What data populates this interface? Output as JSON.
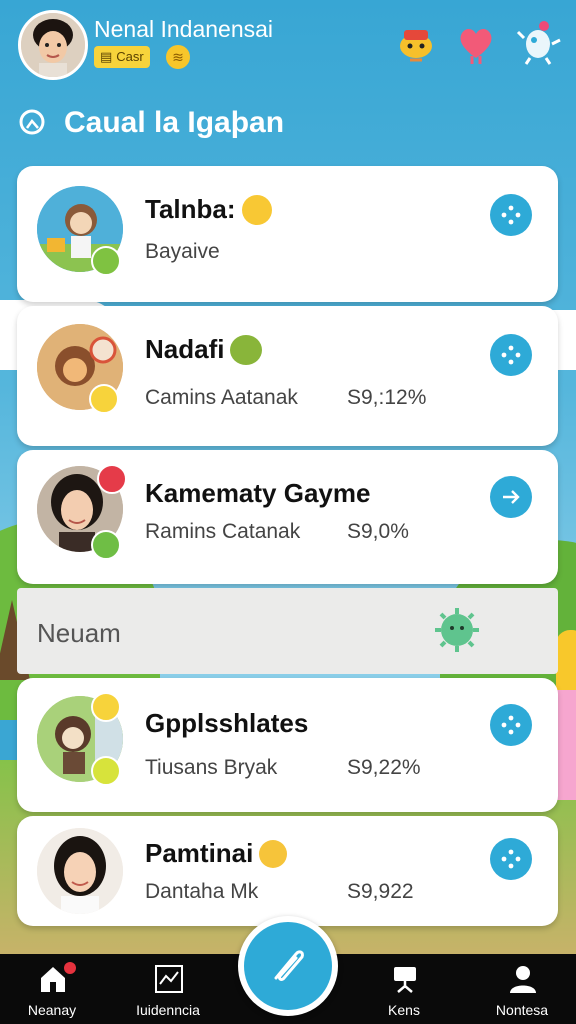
{
  "header": {
    "user_name": "Nenal Indanensai",
    "badge_label": "Casr"
  },
  "search": {
    "text": "Caual la Igaþan"
  },
  "cards": [
    {
      "title": "Talnba:",
      "subtitle": "Bayaive",
      "percent": ""
    },
    {
      "title": "Nadafi",
      "subtitle": "Camins Aatanak",
      "percent": "S9,:12%"
    },
    {
      "title": "Kamematy Gayme",
      "subtitle": "Ramins Catanak",
      "percent": "S9,0%"
    },
    {
      "title": "Gpplsshlates",
      "subtitle": "Tiusans Bryak",
      "percent": "S9,22%"
    },
    {
      "title": "Pamtinai",
      "subtitle": "Dantaha Mk",
      "percent": "S9,922"
    }
  ],
  "section": {
    "label": "Neuam"
  },
  "nav": {
    "items": [
      {
        "label": "Neanay"
      },
      {
        "label": "Iuidenncia"
      },
      {
        "label": "Kens"
      },
      {
        "label": "Nontesa"
      }
    ]
  },
  "colors": {
    "accent": "#2eaad7",
    "sky": "#38a6d4",
    "nav_bg": "#0a0a0a",
    "badge": "#f7d33b"
  }
}
